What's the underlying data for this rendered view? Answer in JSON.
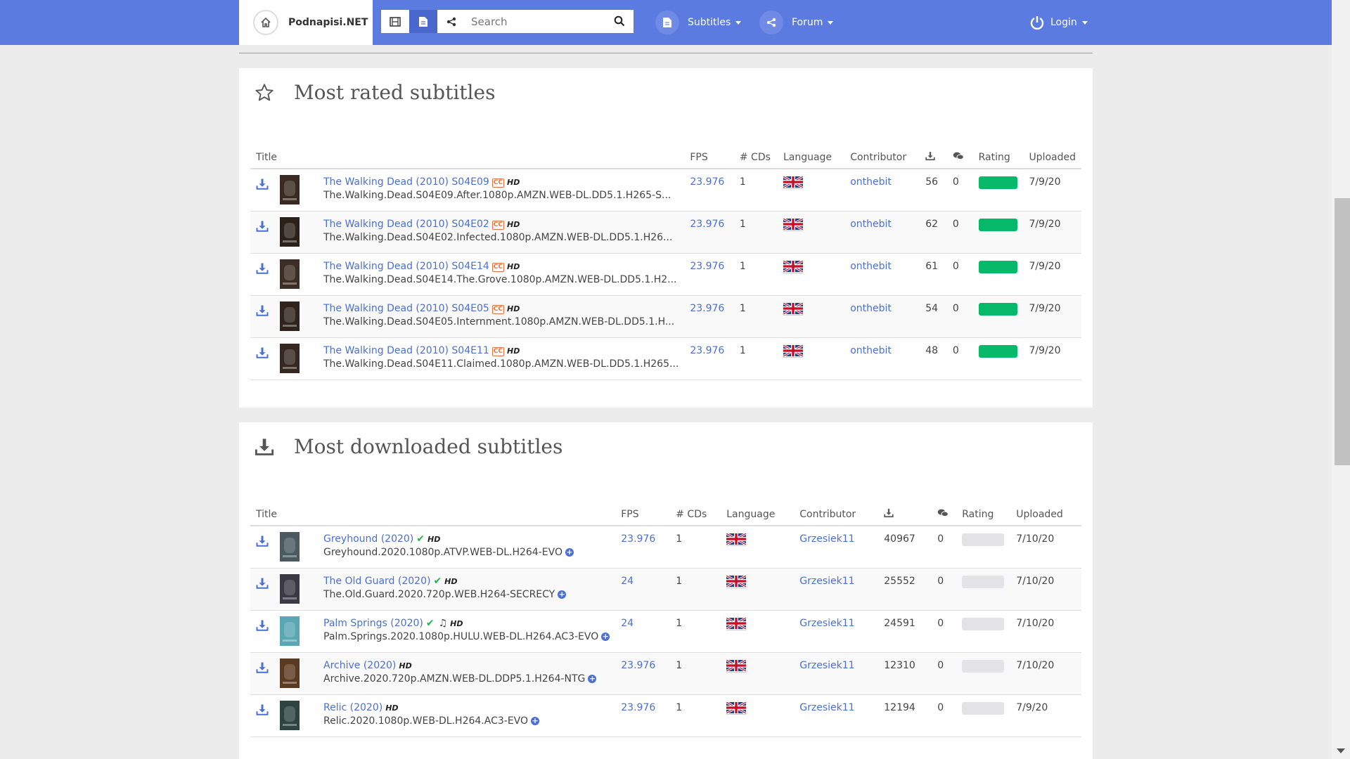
{
  "nav": {
    "brand": "Podnapisi.NET",
    "search_placeholder": "Search",
    "subtitles_label": "Subtitles",
    "forum_label": "Forum",
    "login_label": "Login"
  },
  "most_rated": {
    "title": "Most rated subtitles",
    "headers": {
      "title": "Title",
      "fps": "FPS",
      "cds": "# CDs",
      "language": "Language",
      "contributor": "Contributor",
      "rating": "Rating",
      "uploaded": "Uploaded"
    },
    "rows": [
      {
        "title": "The Walking Dead (2010) S04E09",
        "release": "The.Walking.Dead.S04E09.After.1080p.AMZN.WEB-DL.DD5.1.H265-S...",
        "fps": "23.976",
        "cds": "1",
        "contributor": "onthebit",
        "downloads": "56",
        "comments": "0",
        "rating": 1.0,
        "uploaded": "7/9/20"
      },
      {
        "title": "The Walking Dead (2010) S04E02",
        "release": "The.Walking.Dead.S04E02.Infected.1080p.AMZN.WEB-DL.DD5.1.H26...",
        "fps": "23.976",
        "cds": "1",
        "contributor": "onthebit",
        "downloads": "62",
        "comments": "0",
        "rating": 1.0,
        "uploaded": "7/9/20"
      },
      {
        "title": "The Walking Dead (2010) S04E14",
        "release": "The.Walking.Dead.S04E14.The.Grove.1080p.AMZN.WEB-DL.DD5.1.H2...",
        "fps": "23.976",
        "cds": "1",
        "contributor": "onthebit",
        "downloads": "61",
        "comments": "0",
        "rating": 1.0,
        "uploaded": "7/9/20"
      },
      {
        "title": "The Walking Dead (2010) S04E05",
        "release": "The.Walking.Dead.S04E05.Internment.1080p.AMZN.WEB-DL.DD5.1.H...",
        "fps": "23.976",
        "cds": "1",
        "contributor": "onthebit",
        "downloads": "54",
        "comments": "0",
        "rating": 1.0,
        "uploaded": "7/9/20"
      },
      {
        "title": "The Walking Dead (2010) S04E11",
        "release": "The.Walking.Dead.S04E11.Claimed.1080p.AMZN.WEB-DL.DD5.1.H265...",
        "fps": "23.976",
        "cds": "1",
        "contributor": "onthebit",
        "downloads": "48",
        "comments": "0",
        "rating": 1.0,
        "uploaded": "7/9/20"
      }
    ]
  },
  "most_downloaded": {
    "title": "Most downloaded subtitles",
    "headers": {
      "title": "Title",
      "fps": "FPS",
      "cds": "# CDs",
      "language": "Language",
      "contributor": "Contributor",
      "rating": "Rating",
      "uploaded": "Uploaded"
    },
    "rows": [
      {
        "title": "Greyhound (2020)",
        "release": "Greyhound.2020.1080p.ATVP.WEB-DL.H264-EVO",
        "fps": "23.976",
        "cds": "1",
        "contributor": "Grzesiek11",
        "downloads": "40967",
        "comments": "0",
        "uploaded": "7/10/20"
      },
      {
        "title": "The Old Guard (2020)",
        "release": "The.Old.Guard.2020.720p.WEB.H264-SECRECY",
        "fps": "24",
        "cds": "1",
        "contributor": "Grzesiek11",
        "downloads": "25552",
        "comments": "0",
        "uploaded": "7/10/20"
      },
      {
        "title": "Palm Springs (2020)",
        "release": "Palm.Springs.2020.1080p.HULU.WEB-DL.H264.AC3-EVO",
        "fps": "24",
        "cds": "1",
        "contributor": "Grzesiek11",
        "downloads": "24591",
        "comments": "0",
        "uploaded": "7/10/20"
      },
      {
        "title": "Archive (2020)",
        "release": "Archive.2020.720p.AMZN.WEB-DL.DDP5.1.H264-NTG",
        "fps": "23.976",
        "cds": "1",
        "contributor": "Grzesiek11",
        "downloads": "12310",
        "comments": "0",
        "uploaded": "7/10/20"
      },
      {
        "title": "Relic (2020)",
        "release": "Relic.2020.1080p.WEB-DL.H264.AC3-EVO",
        "fps": "23.976",
        "cds": "1",
        "contributor": "Grzesiek11",
        "downloads": "12194",
        "comments": "0",
        "uploaded": "7/9/20"
      }
    ]
  },
  "hd_badge": "HD",
  "cc_badge": "CC",
  "colors": {
    "navbar": "#5b7be0",
    "link": "#4a6fd6",
    "rating_green": "#05b86a"
  },
  "icons": [
    "home-icon",
    "film-icon",
    "document-icon",
    "share-icon",
    "search-icon",
    "power-icon",
    "star-icon",
    "download-icon",
    "comment-icon",
    "uk-flag-icon"
  ]
}
